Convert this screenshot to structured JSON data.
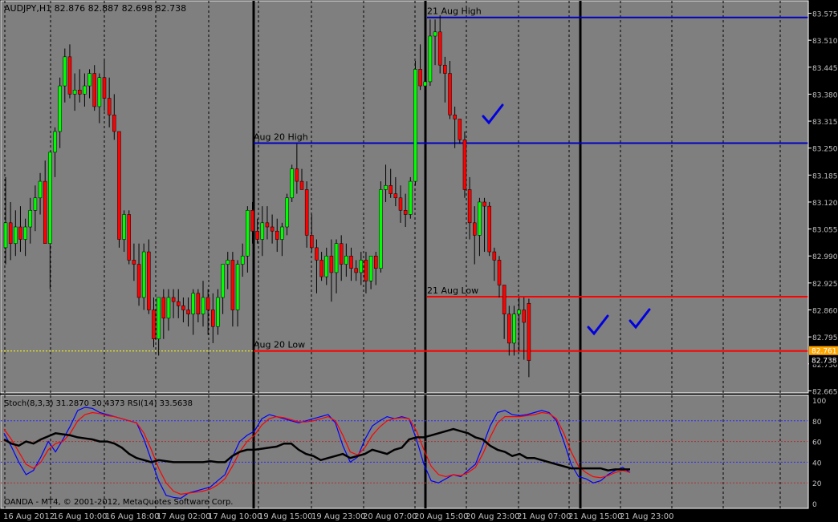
{
  "header": {
    "symbol_info": "AUDJPY,H1  82.876 82.887 82.698 82.738",
    "indicator_info": "Stoch(8,3,3) 31.2870 30.4373  RSI(14) 33.5638",
    "copyright": "OANDA - MT4, © 2001-2012, MetaQuotes Software Corp."
  },
  "colors": {
    "background": "#7f7f7f",
    "bull": "#00ff00",
    "bear": "#ff0000",
    "high_level": "#0000c0",
    "low_level": "#ff0000",
    "stoch_main": "#0000ff",
    "stoch_signal": "#ff0000",
    "rsi": "#000000",
    "checkmark": "#0000e0",
    "price_tag_current": "#000000",
    "price_tag_level": "#ffa500"
  },
  "chart_data": [
    {
      "type": "candlestick",
      "title": "AUDJPY,H1",
      "ohlc_current": {
        "open": 82.876,
        "high": 82.887,
        "low": 82.698,
        "close": 82.738
      },
      "ylim": [
        82.66,
        83.605
      ],
      "yticks": [
        "83.575",
        "83.510",
        "83.445",
        "83.380",
        "83.315",
        "83.250",
        "83.185",
        "83.120",
        "83.055",
        "82.990",
        "82.925",
        "82.860",
        "82.795",
        "82.730",
        "82.665"
      ],
      "xticks": [
        "16 Aug 2012",
        "16 Aug 10:00",
        "16 Aug 18:00",
        "17 Aug 02:00",
        "17 Aug 10:00",
        "19 Aug 15:00",
        "19 Aug 23:00",
        "20 Aug 07:00",
        "20 Aug 15:00",
        "20 Aug 23:00",
        "21 Aug 07:00",
        "21 Aug 15:00",
        "21 Aug 23:00"
      ],
      "candles": [
        [
          83.01,
          83.18,
          82.97,
          83.07
        ],
        [
          83.07,
          83.12,
          82.98,
          83.02
        ],
        [
          83.02,
          83.1,
          82.99,
          83.06
        ],
        [
          83.06,
          83.11,
          83.0,
          83.03
        ],
        [
          83.03,
          83.08,
          82.99,
          83.06
        ],
        [
          83.06,
          83.13,
          83.02,
          83.1
        ],
        [
          83.1,
          83.16,
          83.05,
          83.13
        ],
        [
          83.13,
          83.19,
          83.09,
          83.17
        ],
        [
          83.17,
          83.22,
          83.1,
          83.02
        ],
        [
          83.02,
          83.24,
          82.91,
          83.24
        ],
        [
          83.24,
          83.3,
          83.18,
          83.29
        ],
        [
          83.29,
          83.42,
          83.25,
          83.4
        ],
        [
          83.4,
          83.49,
          83.36,
          83.47
        ],
        [
          83.47,
          83.5,
          83.37,
          83.38
        ],
        [
          83.38,
          83.43,
          83.34,
          83.39
        ],
        [
          83.39,
          83.44,
          83.36,
          83.38
        ],
        [
          83.38,
          83.43,
          83.35,
          83.4
        ],
        [
          83.4,
          83.44,
          83.37,
          83.43
        ],
        [
          83.43,
          83.45,
          83.34,
          83.35
        ],
        [
          83.35,
          83.43,
          83.31,
          83.42
        ],
        [
          83.42,
          83.46,
          83.34,
          83.37
        ],
        [
          83.37,
          83.42,
          83.3,
          83.33
        ],
        [
          83.33,
          83.38,
          83.27,
          83.29
        ],
        [
          83.29,
          83.29,
          83.01,
          83.03
        ],
        [
          83.03,
          83.1,
          83.0,
          83.09
        ],
        [
          83.09,
          83.1,
          82.97,
          82.98
        ],
        [
          82.98,
          83.02,
          82.93,
          82.97
        ],
        [
          82.97,
          83.02,
          82.87,
          82.89
        ],
        [
          82.89,
          83.02,
          82.86,
          83.0
        ],
        [
          83.0,
          83.03,
          82.85,
          82.86
        ],
        [
          82.86,
          82.89,
          82.77,
          82.79
        ],
        [
          82.79,
          82.89,
          82.75,
          82.89
        ],
        [
          82.89,
          82.91,
          82.79,
          82.84
        ],
        [
          82.84,
          82.91,
          82.81,
          82.89
        ],
        [
          82.89,
          82.91,
          82.84,
          82.88
        ],
        [
          82.88,
          82.91,
          82.84,
          82.87
        ],
        [
          82.87,
          82.89,
          82.83,
          82.86
        ],
        [
          82.86,
          82.89,
          82.82,
          82.85
        ],
        [
          82.85,
          82.91,
          82.8,
          82.9
        ],
        [
          82.9,
          82.91,
          82.83,
          82.85
        ],
        [
          82.85,
          82.93,
          82.82,
          82.89
        ],
        [
          82.89,
          82.91,
          82.8,
          82.86
        ],
        [
          82.86,
          82.9,
          82.78,
          82.82
        ],
        [
          82.82,
          82.91,
          82.8,
          82.89
        ],
        [
          82.89,
          82.97,
          82.85,
          82.97
        ],
        [
          82.97,
          83.0,
          82.91,
          82.98
        ],
        [
          82.98,
          83.0,
          82.82,
          82.86
        ],
        [
          82.86,
          82.98,
          82.82,
          82.97
        ],
        [
          82.97,
          83.02,
          82.94,
          82.99
        ],
        [
          82.99,
          83.11,
          82.95,
          83.1
        ],
        [
          83.1,
          83.12,
          83.02,
          83.05
        ],
        [
          83.05,
          83.08,
          83.02,
          83.03
        ],
        [
          83.03,
          83.11,
          82.99,
          83.07
        ],
        [
          83.07,
          83.11,
          83.03,
          83.06
        ],
        [
          83.06,
          83.09,
          83.02,
          83.05
        ],
        [
          83.05,
          83.08,
          83.0,
          83.03
        ],
        [
          83.03,
          83.07,
          82.99,
          83.06
        ],
        [
          83.06,
          83.14,
          83.04,
          83.13
        ],
        [
          83.13,
          83.21,
          83.12,
          83.2
        ],
        [
          83.2,
          83.26,
          83.14,
          83.17
        ],
        [
          83.17,
          83.2,
          83.15,
          83.15
        ],
        [
          83.15,
          83.17,
          83.01,
          83.04
        ],
        [
          83.04,
          83.09,
          83.0,
          83.01
        ],
        [
          83.01,
          83.03,
          82.9,
          82.98
        ],
        [
          82.98,
          83.0,
          82.93,
          82.94
        ],
        [
          82.94,
          83.01,
          82.92,
          82.99
        ],
        [
          82.99,
          83.03,
          82.88,
          82.95
        ],
        [
          82.95,
          83.03,
          82.9,
          83.02
        ],
        [
          83.02,
          83.04,
          82.93,
          82.97
        ],
        [
          82.97,
          83.02,
          82.94,
          82.99
        ],
        [
          82.99,
          83.01,
          82.93,
          82.96
        ],
        [
          82.96,
          82.98,
          82.93,
          82.95
        ],
        [
          82.95,
          83.0,
          82.92,
          82.98
        ],
        [
          82.98,
          83.0,
          82.9,
          82.93
        ],
        [
          82.93,
          82.99,
          82.91,
          82.99
        ],
        [
          82.99,
          83.0,
          82.92,
          82.96
        ],
        [
          82.96,
          83.17,
          82.95,
          83.15
        ],
        [
          83.15,
          83.21,
          83.12,
          83.16
        ],
        [
          83.16,
          83.2,
          83.13,
          83.14
        ],
        [
          83.14,
          83.18,
          83.11,
          83.13
        ],
        [
          83.13,
          83.16,
          83.07,
          83.1
        ],
        [
          83.1,
          83.14,
          83.06,
          83.09
        ],
        [
          83.09,
          83.18,
          83.08,
          83.17
        ],
        [
          83.17,
          83.46,
          83.16,
          83.44
        ],
        [
          83.44,
          83.5,
          83.39,
          83.4
        ],
        [
          83.4,
          83.48,
          83.38,
          83.41
        ],
        [
          83.41,
          83.56,
          83.4,
          83.52
        ],
        [
          83.52,
          83.56,
          83.45,
          83.53
        ],
        [
          83.53,
          83.57,
          83.43,
          83.45
        ],
        [
          83.45,
          83.47,
          83.36,
          83.43
        ],
        [
          83.43,
          83.46,
          83.32,
          83.33
        ],
        [
          83.33,
          83.35,
          83.25,
          83.32
        ],
        [
          83.32,
          83.32,
          83.26,
          83.27
        ],
        [
          83.27,
          83.29,
          83.13,
          83.15
        ],
        [
          83.15,
          83.18,
          83.03,
          83.07
        ],
        [
          83.07,
          83.11,
          82.97,
          83.04
        ],
        [
          83.04,
          83.13,
          82.99,
          83.12
        ],
        [
          83.12,
          83.13,
          83.0,
          83.11
        ],
        [
          83.11,
          83.12,
          82.99,
          83.0
        ],
        [
          83.0,
          83.01,
          82.93,
          82.98
        ],
        [
          82.98,
          82.99,
          82.89,
          82.92
        ],
        [
          82.92,
          82.92,
          82.79,
          82.85
        ],
        [
          82.85,
          82.87,
          82.75,
          82.78
        ],
        [
          82.78,
          82.87,
          82.75,
          82.85
        ],
        [
          82.85,
          82.89,
          82.76,
          82.86
        ],
        [
          82.86,
          82.89,
          82.74,
          82.83
        ],
        [
          82.876,
          82.887,
          82.698,
          82.738
        ]
      ],
      "levels": [
        {
          "label": "21 Aug High",
          "value": 83.565,
          "color": "#0000c0"
        },
        {
          "label": "Aug 20 High",
          "value": 83.262,
          "color": "#0000c0"
        },
        {
          "label": "21 Aug Low",
          "value": 82.892,
          "color": "#ff0000"
        },
        {
          "label": "Aug 20 Low",
          "value": 82.761,
          "color": "#ff0000"
        }
      ],
      "price_tags": [
        {
          "value": "82.761",
          "color": "#ffa500"
        },
        {
          "value": "82.738",
          "color": "#000000"
        }
      ],
      "checkmarks_at_candle": [
        77,
        107,
        111
      ]
    },
    {
      "type": "line",
      "title": "Stoch(8,3,3) RSI(14)",
      "ylim": [
        0,
        100
      ],
      "yticks": [
        "100",
        "80",
        "60",
        "40",
        "20",
        "0"
      ],
      "series": [
        {
          "name": "Stoch main",
          "color": "#0000ff",
          "values": [
            68,
            55,
            40,
            28,
            32,
            45,
            60,
            50,
            62,
            75,
            90,
            93,
            92,
            88,
            86,
            84,
            82,
            80,
            78,
            62,
            42,
            22,
            8,
            6,
            5,
            10,
            12,
            14,
            16,
            22,
            28,
            45,
            60,
            66,
            70,
            82,
            86,
            84,
            82,
            80,
            78,
            80,
            82,
            84,
            86,
            78,
            56,
            40,
            45,
            62,
            75,
            80,
            84,
            82,
            84,
            82,
            62,
            38,
            22,
            20,
            24,
            28,
            26,
            32,
            38,
            56,
            75,
            88,
            90,
            86,
            85,
            86,
            88,
            90,
            88,
            80,
            60,
            38,
            26,
            24,
            20,
            22,
            28,
            32,
            35,
            30
          ]
        },
        {
          "name": "Stoch signal",
          "color": "#ff0000",
          "values": [
            72,
            62,
            50,
            38,
            34,
            40,
            52,
            58,
            60,
            68,
            80,
            86,
            88,
            87,
            85,
            84,
            82,
            80,
            78,
            68,
            52,
            34,
            20,
            12,
            9,
            10,
            11,
            12,
            14,
            18,
            24,
            36,
            50,
            60,
            66,
            76,
            82,
            84,
            83,
            81,
            79,
            79,
            80,
            82,
            84,
            80,
            66,
            50,
            47,
            54,
            66,
            74,
            80,
            82,
            83,
            82,
            70,
            52,
            36,
            28,
            26,
            28,
            27,
            30,
            35,
            48,
            64,
            78,
            84,
            84,
            84,
            85,
            86,
            88,
            87,
            82,
            68,
            50,
            36,
            30,
            26,
            25,
            27,
            30,
            32,
            30
          ]
        },
        {
          "name": "RSI",
          "color": "#000000",
          "values": [
            62,
            58,
            56,
            60,
            58,
            62,
            65,
            68,
            67,
            66,
            64,
            63,
            62,
            60,
            60,
            58,
            54,
            48,
            44,
            42,
            40,
            42,
            41,
            40,
            40,
            40,
            40,
            40,
            41,
            40,
            40,
            46,
            50,
            52,
            52,
            53,
            54,
            55,
            58,
            58,
            52,
            48,
            46,
            42,
            44,
            46,
            48,
            44,
            46,
            48,
            52,
            50,
            48,
            52,
            54,
            62,
            64,
            64,
            66,
            68,
            70,
            72,
            70,
            68,
            64,
            62,
            56,
            52,
            50,
            46,
            48,
            44,
            44,
            42,
            40,
            38,
            36,
            34,
            34,
            34,
            34,
            34,
            32,
            33,
            33,
            33
          ]
        },
        {
          "name": "Level 80",
          "color": "#4040ff",
          "values": [
            80
          ]
        },
        {
          "name": "Level 20",
          "color": "#c04040",
          "values": [
            20
          ]
        }
      ]
    }
  ]
}
